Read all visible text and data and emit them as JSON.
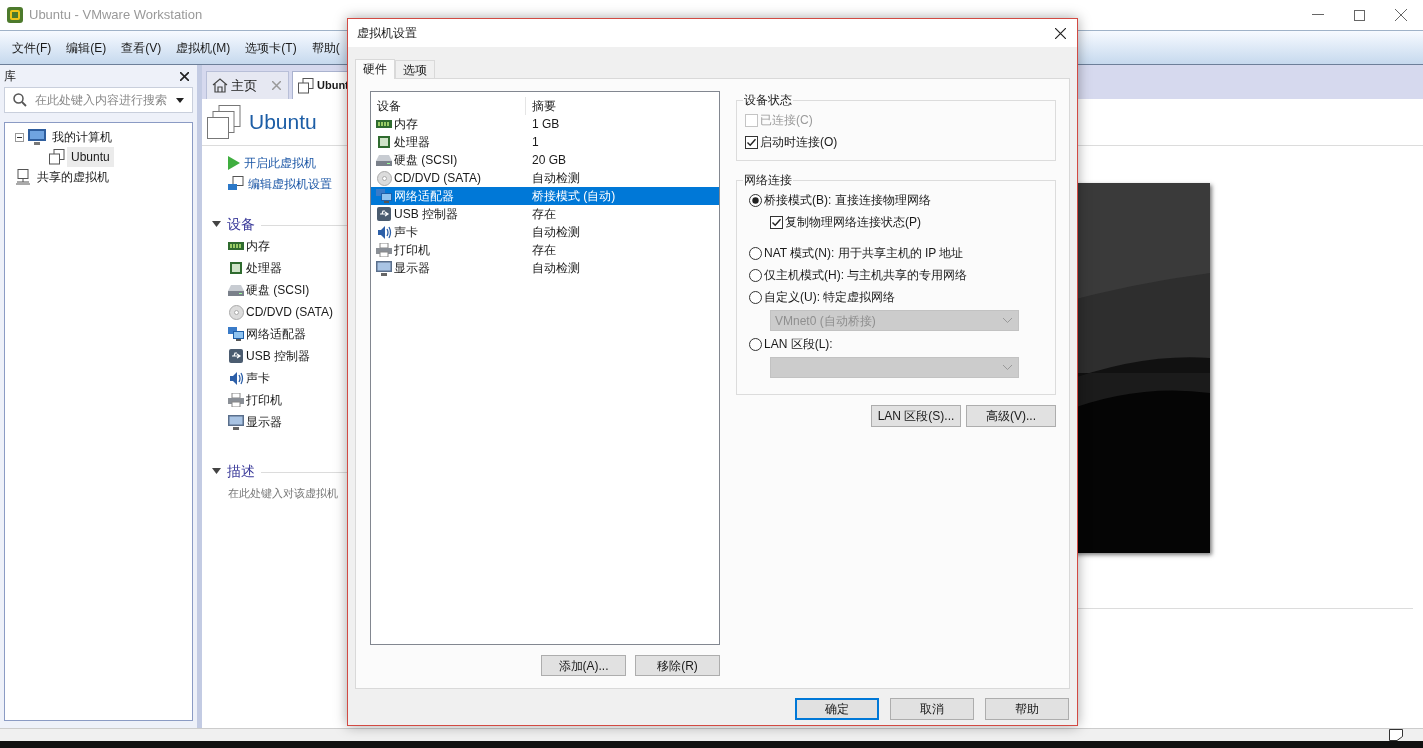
{
  "window": {
    "title": "Ubuntu - VMware Workstation"
  },
  "menu_bar": [
    "文件(F)",
    "编辑(E)",
    "查看(V)",
    "虚拟机(M)",
    "选项卡(T)",
    "帮助("
  ],
  "library": {
    "title": "库",
    "search": {
      "placeholder": "在此处键入内容进行搜索"
    },
    "tree": [
      {
        "label": "我的计算机",
        "kind": "computer",
        "expanded": true,
        "selected": false,
        "children": [
          {
            "label": "Ubuntu",
            "kind": "vm",
            "selected": true
          }
        ]
      },
      {
        "label": "共享的虚拟机",
        "kind": "shared",
        "selected": false
      }
    ]
  },
  "tabs": [
    {
      "label": "主页",
      "kind": "home",
      "selected": false
    },
    {
      "label": "Ubunt",
      "kind": "vm",
      "selected": true
    }
  ],
  "vm_page": {
    "title": "Ubuntu",
    "actions": [
      {
        "kind": "power_on",
        "label": "开启此虚拟机"
      },
      {
        "kind": "edit",
        "label": "编辑虚拟机设置"
      }
    ],
    "devices": {
      "title": "设备",
      "expanded": true,
      "items": [
        {
          "kind": "memory",
          "label": "内存"
        },
        {
          "kind": "cpu",
          "label": "处理器"
        },
        {
          "kind": "disk",
          "label": "硬盘 (SCSI)"
        },
        {
          "kind": "cdrom",
          "label": "CD/DVD (SATA)"
        },
        {
          "kind": "network",
          "label": "网络适配器"
        },
        {
          "kind": "usb",
          "label": "USB 控制器"
        },
        {
          "kind": "sound",
          "label": "声卡"
        },
        {
          "kind": "printer",
          "label": "打印机"
        },
        {
          "kind": "display",
          "label": "显示器"
        }
      ]
    },
    "description": {
      "title": "描述",
      "expanded": true,
      "placeholder": "在此处键入对该虚拟机"
    }
  },
  "dialog": {
    "title": "虚拟机设置",
    "tabs": [
      {
        "label": "硬件",
        "selected": true
      },
      {
        "label": "选项",
        "selected": false
      }
    ],
    "device_table": {
      "columns": [
        "设备",
        "摘要"
      ],
      "rows": [
        {
          "kind": "memory",
          "device": "内存",
          "summary": "1 GB",
          "selected": false
        },
        {
          "kind": "cpu",
          "device": "处理器",
          "summary": "1",
          "selected": false
        },
        {
          "kind": "disk",
          "device": "硬盘 (SCSI)",
          "summary": "20 GB",
          "selected": false
        },
        {
          "kind": "cdrom",
          "device": "CD/DVD (SATA)",
          "summary": "自动检测",
          "selected": false
        },
        {
          "kind": "network",
          "device": "网络适配器",
          "summary": "桥接模式 (自动)",
          "selected": true
        },
        {
          "kind": "usb",
          "device": "USB 控制器",
          "summary": "存在",
          "selected": false
        },
        {
          "kind": "sound",
          "device": "声卡",
          "summary": "自动检测",
          "selected": false
        },
        {
          "kind": "printer",
          "device": "打印机",
          "summary": "存在",
          "selected": false
        },
        {
          "kind": "display",
          "device": "显示器",
          "summary": "自动检测",
          "selected": false
        }
      ]
    },
    "table_buttons": [
      "添加(A)...",
      "移除(R)"
    ],
    "device_status": {
      "title": "设备状态",
      "options": [
        {
          "label": "已连接(C)",
          "checked": false,
          "disabled": true
        },
        {
          "label": "启动时连接(O)",
          "checked": true,
          "disabled": false
        }
      ]
    },
    "network_connection": {
      "title": "网络连接",
      "items": [
        {
          "kind": "radio",
          "label": "桥接模式(B): 直接连接物理网络",
          "selected": true
        },
        {
          "kind": "checkbox",
          "label": "复制物理网络连接状态(P)",
          "checked": true
        },
        {
          "kind": "radio",
          "label": "NAT 模式(N): 用于共享主机的 IP 地址",
          "selected": false
        },
        {
          "kind": "radio",
          "label": "仅主机模式(H): 与主机共享的专用网络",
          "selected": false
        },
        {
          "kind": "radio",
          "label": "自定义(U): 特定虚拟网络",
          "selected": false
        },
        {
          "kind": "select",
          "value": "VMnet0 (自动桥接)",
          "disabled": true
        },
        {
          "kind": "radio",
          "label": "LAN 区段(L):",
          "selected": false
        },
        {
          "kind": "select",
          "disabled": true
        }
      ]
    },
    "side_buttons": [
      "LAN 区段(S)...",
      "高级(V)..."
    ],
    "footer_buttons": [
      {
        "label": "确定",
        "default": true
      },
      {
        "label": "取消",
        "default": false
      },
      {
        "label": "帮助",
        "default": false
      }
    ]
  }
}
